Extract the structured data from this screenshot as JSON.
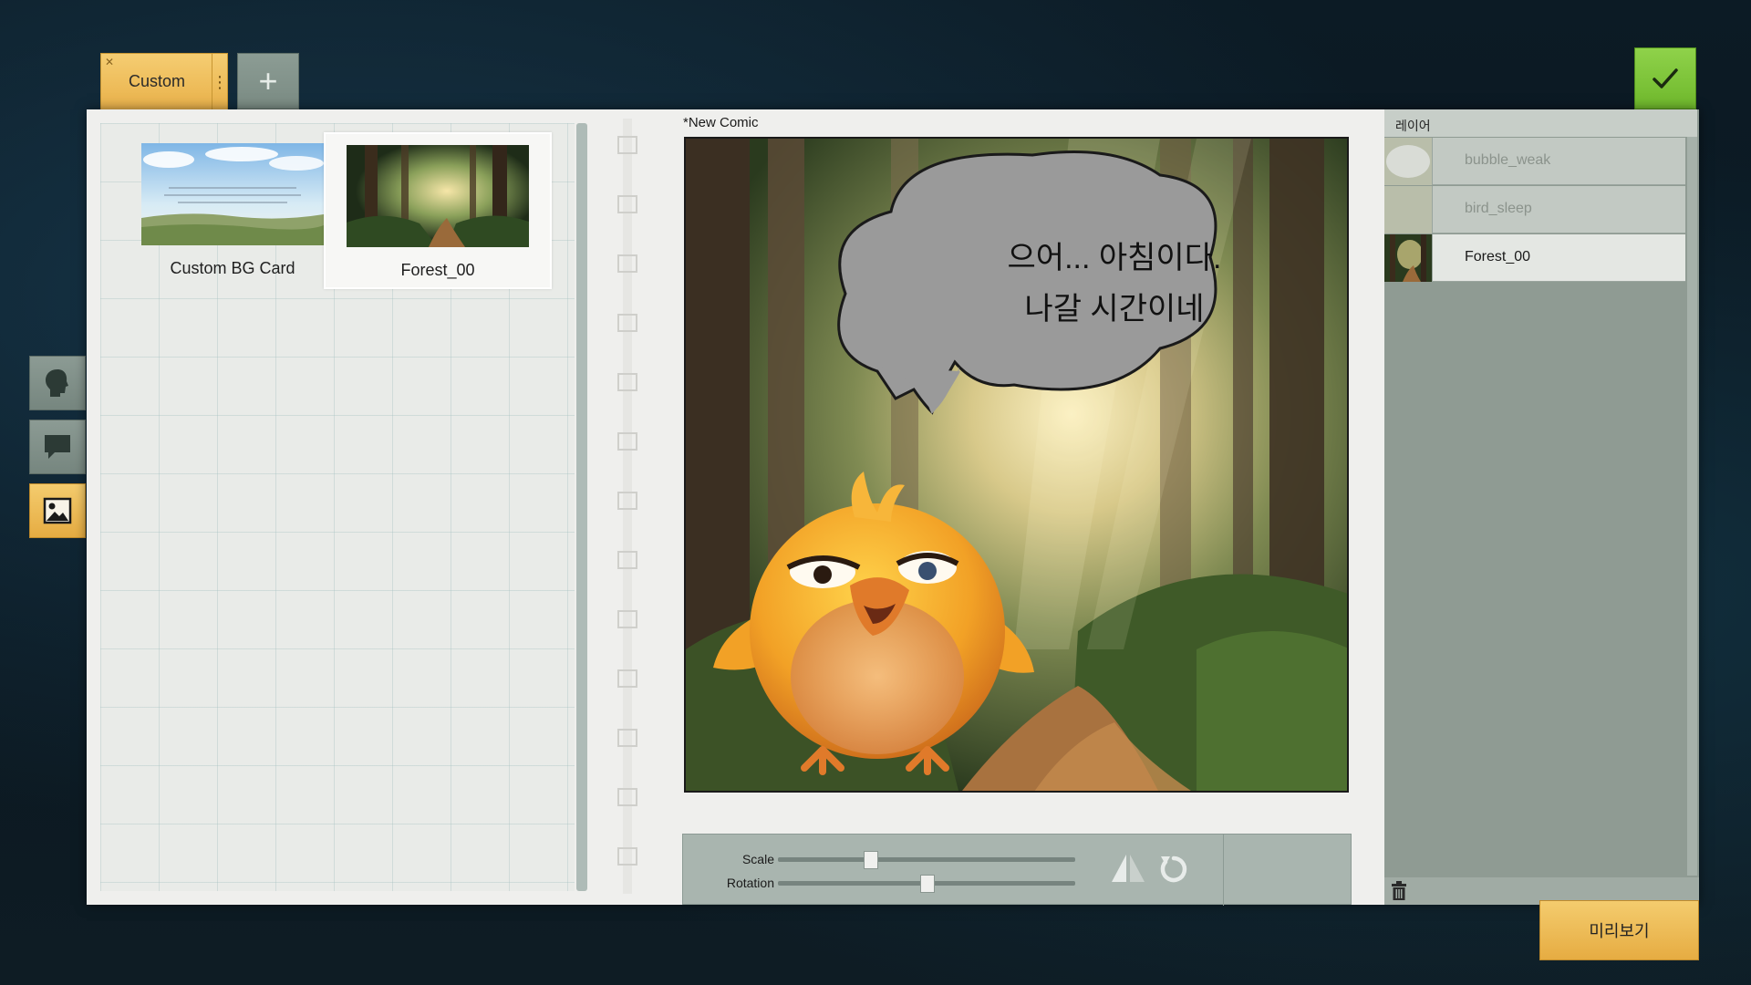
{
  "tabs": [
    {
      "label": "Custom",
      "active": true
    }
  ],
  "tab_actions": {
    "add_icon": "plus-icon",
    "close_icon": "close-icon",
    "menu_icon": "kebab-menu-icon"
  },
  "tools": [
    {
      "name": "character-tool",
      "icon": "head-silhouette-icon",
      "active": false
    },
    {
      "name": "speech-bubble-tool",
      "icon": "speech-bubble-icon",
      "active": false
    },
    {
      "name": "background-tool",
      "icon": "image-icon",
      "active": true
    }
  ],
  "library": {
    "cards": [
      {
        "label": "Custom BG Card",
        "selected": false
      },
      {
        "label": "Forest_00",
        "selected": true
      }
    ]
  },
  "canvas": {
    "title": "*New Comic",
    "speech_line1": "으어... 아침이다.",
    "speech_line2": "나갈 시간이네"
  },
  "transform": {
    "scale_label": "Scale",
    "rotation_label": "Rotation",
    "scale_value": 0.31,
    "rotation_value": 0.5,
    "flip_icon": "flip-horizontal-icon",
    "reset_icon": "rotate-reset-icon"
  },
  "layers": {
    "header": "레이어",
    "items": [
      {
        "name": "bubble_weak",
        "active": false
      },
      {
        "name": "bird_sleep",
        "active": false
      },
      {
        "name": "Forest_00",
        "active": true
      }
    ],
    "trash_icon": "trash-icon"
  },
  "preview_label": "미리보기",
  "confirm_icon": "checkmark-icon",
  "colors": {
    "accent_yellow": "#f0c15f",
    "confirm_green": "#7cc437",
    "panel_gray_green": "#8f9b93"
  }
}
